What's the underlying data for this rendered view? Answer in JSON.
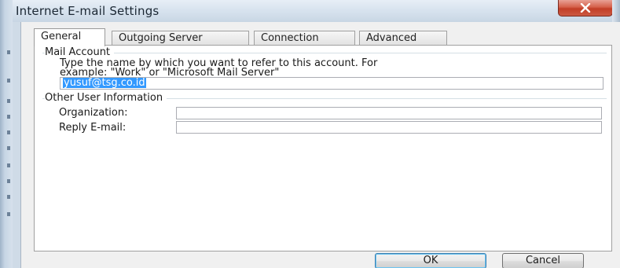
{
  "window": {
    "title": "Internet E-mail Settings"
  },
  "tabs": [
    {
      "label": "General",
      "active": true
    },
    {
      "label": "Outgoing Server",
      "active": false
    },
    {
      "label": "Connection",
      "active": false
    },
    {
      "label": "Advanced",
      "active": false
    }
  ],
  "mail_account": {
    "group_label": "Mail Account",
    "description_line1": "Type the name by which you want to refer to this account.  For",
    "description_line2": "example: \"Work\" or \"Microsoft Mail Server\"",
    "account_name_value": "yusuf@tsg.co.id"
  },
  "other_user_info": {
    "group_label": "Other User Information",
    "organization_label": "Organization:",
    "organization_value": "",
    "reply_email_label": "Reply E-mail:",
    "reply_email_value": ""
  },
  "buttons": {
    "ok_label": "OK",
    "cancel_label": "Cancel"
  },
  "colors": {
    "selection": "#3399ff",
    "close_button": "#c23e26"
  },
  "icons": {
    "close": "close-icon"
  }
}
